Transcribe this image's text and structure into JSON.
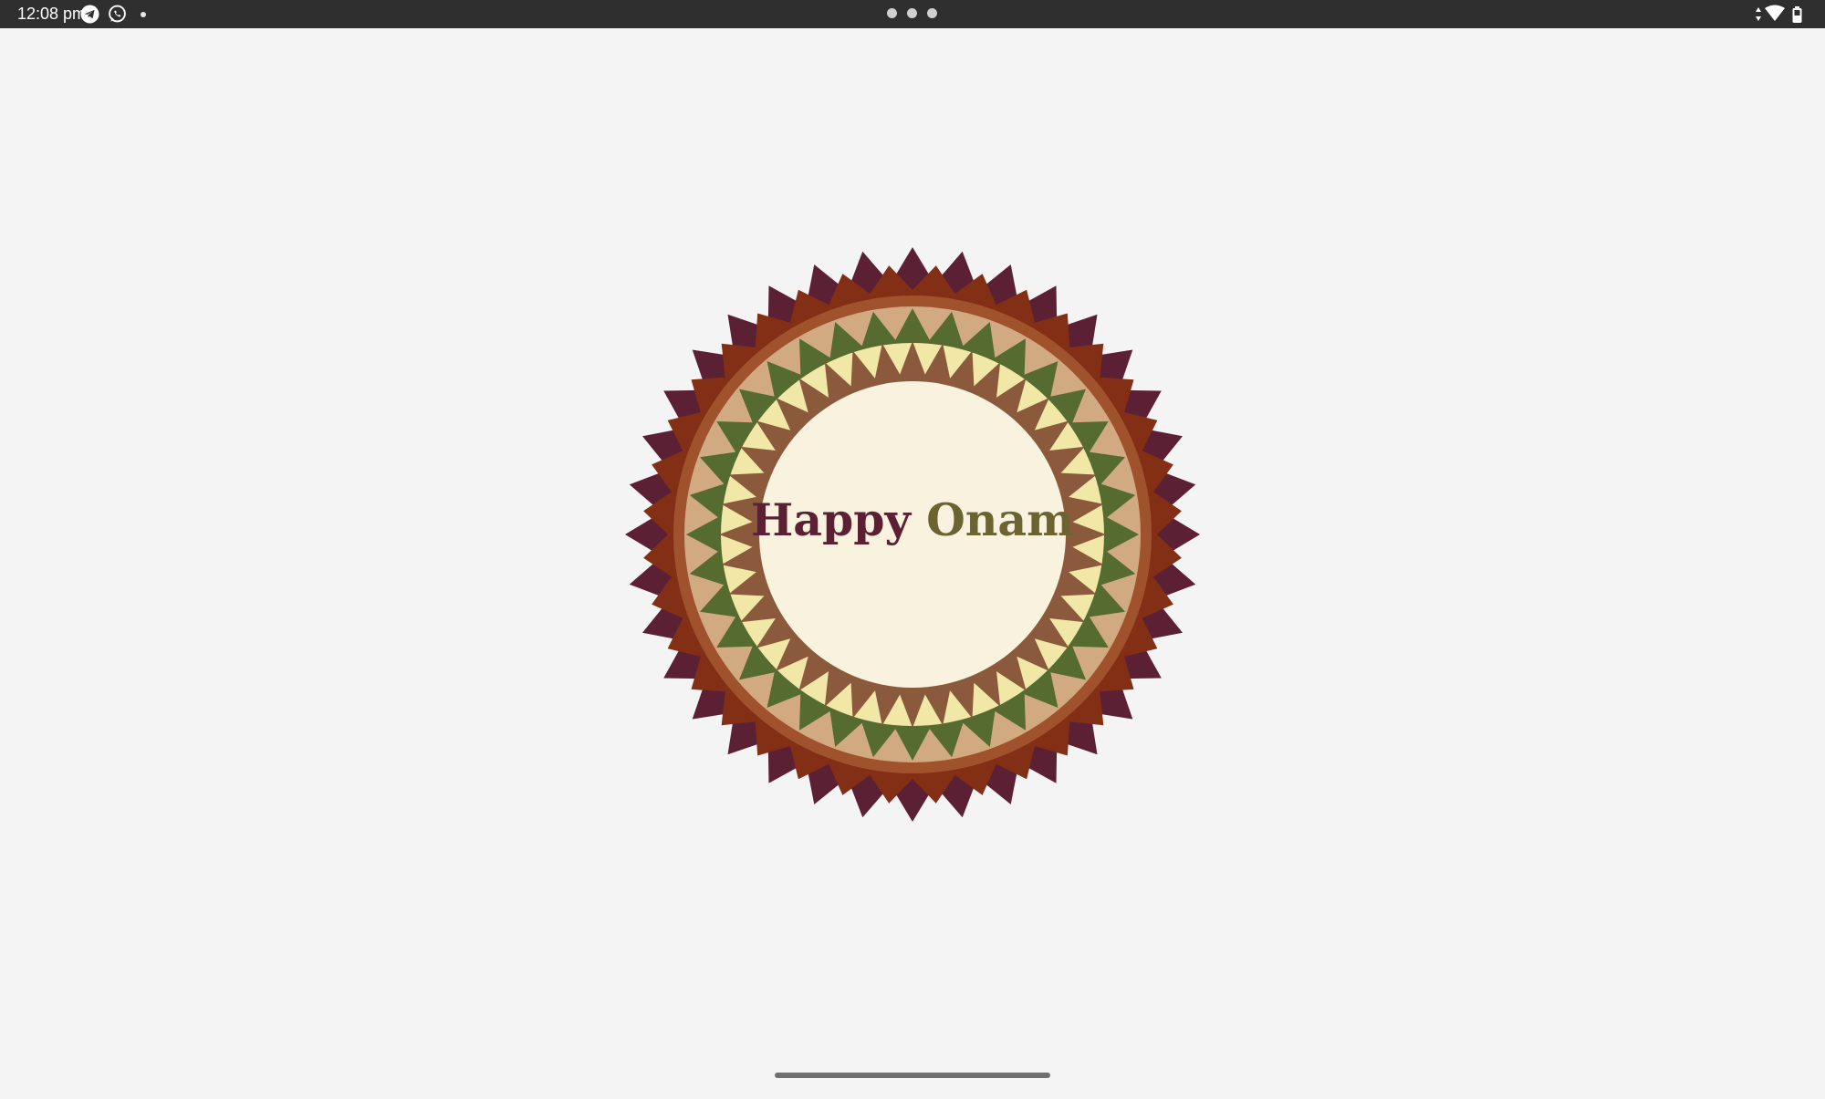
{
  "status_bar": {
    "time": "12:08 pm",
    "notification_icons": [
      "telegram-icon",
      "whatsapp-icon",
      "more-notifications-dot"
    ],
    "system_icons": [
      "data-arrows-icon",
      "wifi-icon",
      "battery-icon"
    ]
  },
  "colors": {
    "background": "#f4f4f4",
    "status_bar": "#2f2f2f",
    "ring_outer": "#5b2033",
    "ring_rust_dark": "#822f15",
    "ring_rust": "#a0522d",
    "ring_tan": "#d2aa82",
    "ring_green": "#556b2f",
    "ring_yellow": "#f1e7a6",
    "ring_brown": "#8b5a3c",
    "center_fill": "#f9f2df",
    "text_dark": "#5b2033",
    "text_olive": "#6b6432"
  },
  "greeting": {
    "text": "Happy Onam"
  },
  "rangoli": {
    "layers": [
      {
        "name": "outer-maroon-ring",
        "points": 36,
        "color": "#5b2033"
      },
      {
        "name": "dark-rust-ring",
        "points": 36,
        "color": "#822f15"
      },
      {
        "name": "rust-ring",
        "points": 0,
        "color": "#a0522d"
      },
      {
        "name": "tan-ring",
        "points": 36,
        "color": "#d2aa82"
      },
      {
        "name": "green-ring",
        "points": 36,
        "color": "#556b2f"
      },
      {
        "name": "yellow-ring",
        "points": 0,
        "color": "#f1e7a6"
      },
      {
        "name": "brown-ring",
        "points": 40,
        "color": "#8b5a3c"
      },
      {
        "name": "center",
        "points": 0,
        "color": "#f9f2df"
      }
    ]
  }
}
